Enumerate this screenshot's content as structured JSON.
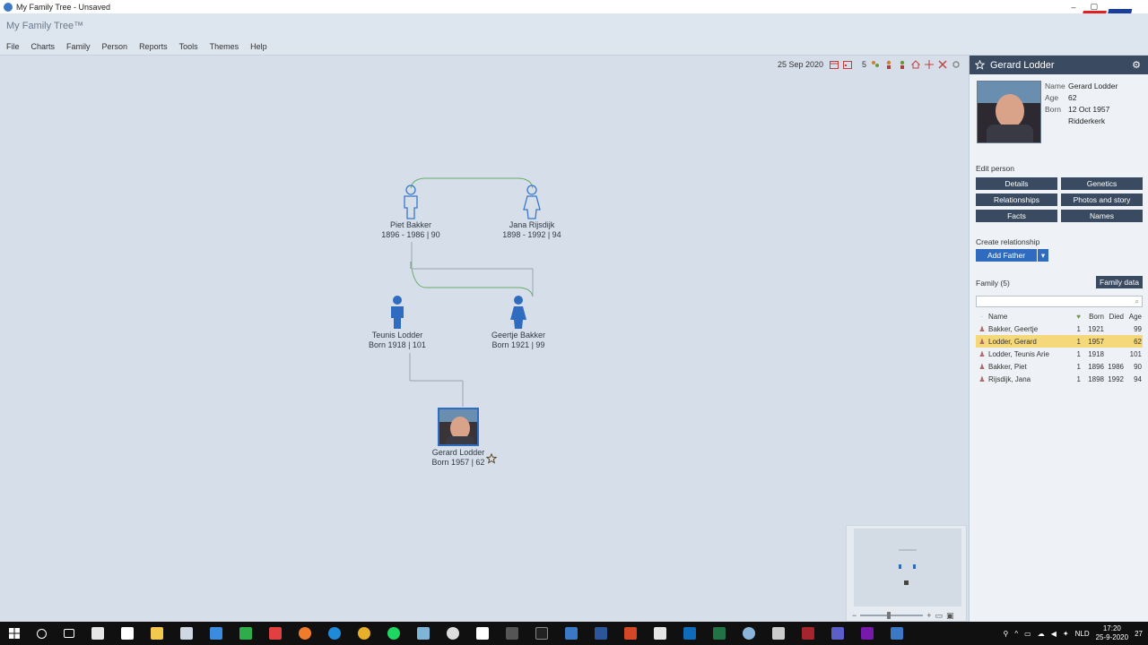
{
  "window": {
    "title": "My Family Tree - Unsaved"
  },
  "app": {
    "brand": "My Family Tree™"
  },
  "menu": [
    "File",
    "Charts",
    "Family",
    "Person",
    "Reports",
    "Tools",
    "Themes",
    "Help"
  ],
  "toolbar": {
    "date": "25 Sep 2020",
    "generations": "5"
  },
  "chart": {
    "people": [
      {
        "name": "Piet Bakker",
        "dates": "1896 - 1986 | 90"
      },
      {
        "name": "Jana Rijsdijk",
        "dates": "1898 - 1992 | 94"
      },
      {
        "name": "Teunis Lodder",
        "dates": "Born 1918 | 101"
      },
      {
        "name": "Geertje Bakker",
        "dates": "Born 1921 | 99"
      },
      {
        "name": "Gerard Lodder",
        "dates": "Born 1957 | 62"
      }
    ]
  },
  "panel": {
    "title": "Gerard Lodder",
    "info": {
      "name_key": "Name",
      "name_val": "Gerard Lodder",
      "age_key": "Age",
      "age_val": "62",
      "born_key": "Born",
      "born_val": "12 Oct 1957",
      "born_place": "Ridderkerk"
    },
    "edit_person_label": "Edit person",
    "edit_buttons": [
      "Details",
      "Genetics",
      "Relationships",
      "Photos and story",
      "Facts",
      "Names"
    ],
    "create_relationship_label": "Create relationship",
    "add_father": "Add Father",
    "family_label": "Family (5)",
    "family_data_button": "Family data",
    "table_headers": {
      "name": "Name",
      "born": "Born",
      "died": "Died",
      "age": "Age"
    },
    "family": [
      {
        "name": "Bakker, Geertje",
        "gen": "1",
        "born": "1921",
        "died": "",
        "age": "99"
      },
      {
        "name": "Lodder, Gerard",
        "gen": "1",
        "born": "1957",
        "died": "",
        "age": "62"
      },
      {
        "name": "Lodder, Teunis Arie",
        "gen": "1",
        "born": "1918",
        "died": "",
        "age": "101"
      },
      {
        "name": "Bakker, Piet",
        "gen": "1",
        "born": "1896",
        "died": "1986",
        "age": "90"
      },
      {
        "name": "Rijsdijk, Jana",
        "gen": "1",
        "born": "1898",
        "died": "1992",
        "age": "94"
      }
    ]
  },
  "taskbar": {
    "language": "NLD",
    "time": "17:20",
    "date": "25-9-2020",
    "notification_count": "27"
  },
  "colors": {
    "panel_dark": "#3a4a60",
    "accent_blue": "#2f6cc0",
    "selected_row": "#f5d87a",
    "person_fill": "#2f6cc0",
    "couple_line": "#6aaa6a"
  }
}
